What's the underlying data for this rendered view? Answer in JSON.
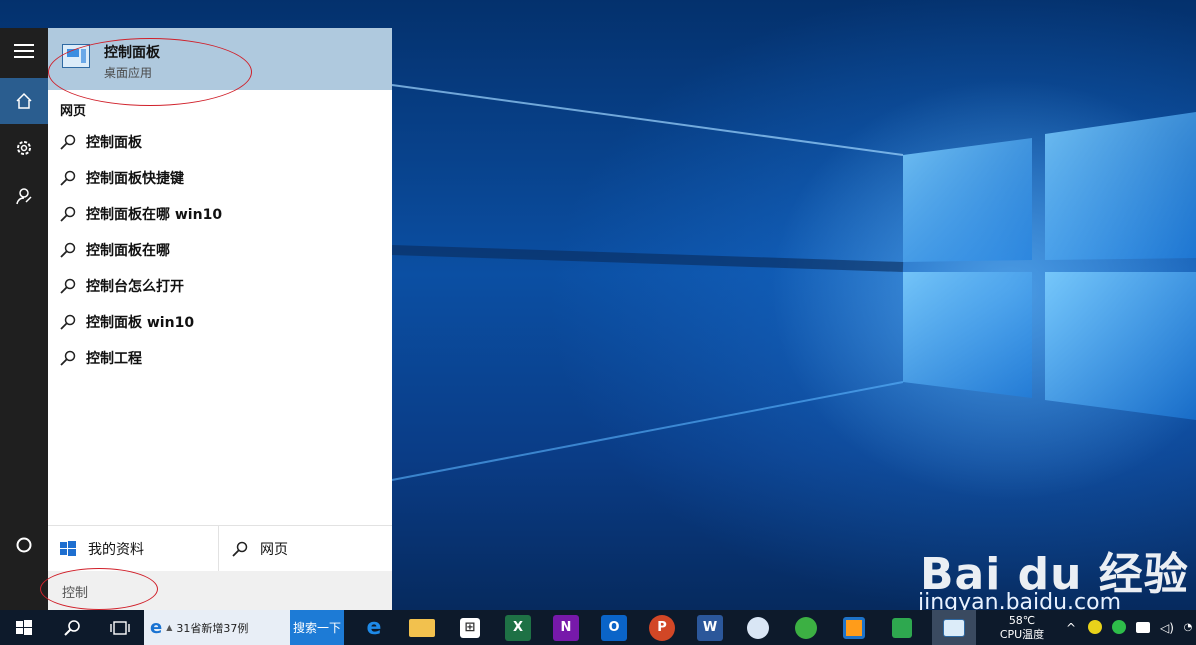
{
  "best_match": {
    "title": "控制面板",
    "subtitle": "桌面应用"
  },
  "web_section": {
    "header": "网页"
  },
  "suggestions": [
    "控制面板",
    "控制面板快捷键",
    "控制面板在哪 win10",
    "控制面板在哪",
    "控制台怎么打开",
    "控制面板 win10",
    "控制工程"
  ],
  "bottom": {
    "my_stuff_label": "我的资料",
    "web_label": "网页"
  },
  "search": {
    "value": "控制"
  },
  "taskbar": {
    "ie_text": "31省新增37例",
    "search_button": "搜索一下",
    "temp_value": "58℃",
    "temp_label": "CPU温度"
  },
  "watermark": {
    "brand": "Bai du 经验",
    "url": "jingyan.baidu.com"
  },
  "colors": {
    "accent": "#2a5d8f",
    "best_match_bg": "#afc9de",
    "annotation": "#d0202a",
    "taskbar": "#0d1a2b"
  },
  "icons": [
    "hamburger-icon",
    "home-icon",
    "gear-icon",
    "feedback-icon",
    "cortana-circle-icon",
    "search-icon",
    "windows-logo-icon",
    "task-view-icon",
    "edge-icon",
    "file-explorer-icon",
    "store-icon",
    "excel-icon",
    "onenote-icon",
    "outlook-icon",
    "powerpoint-icon",
    "word-icon"
  ]
}
